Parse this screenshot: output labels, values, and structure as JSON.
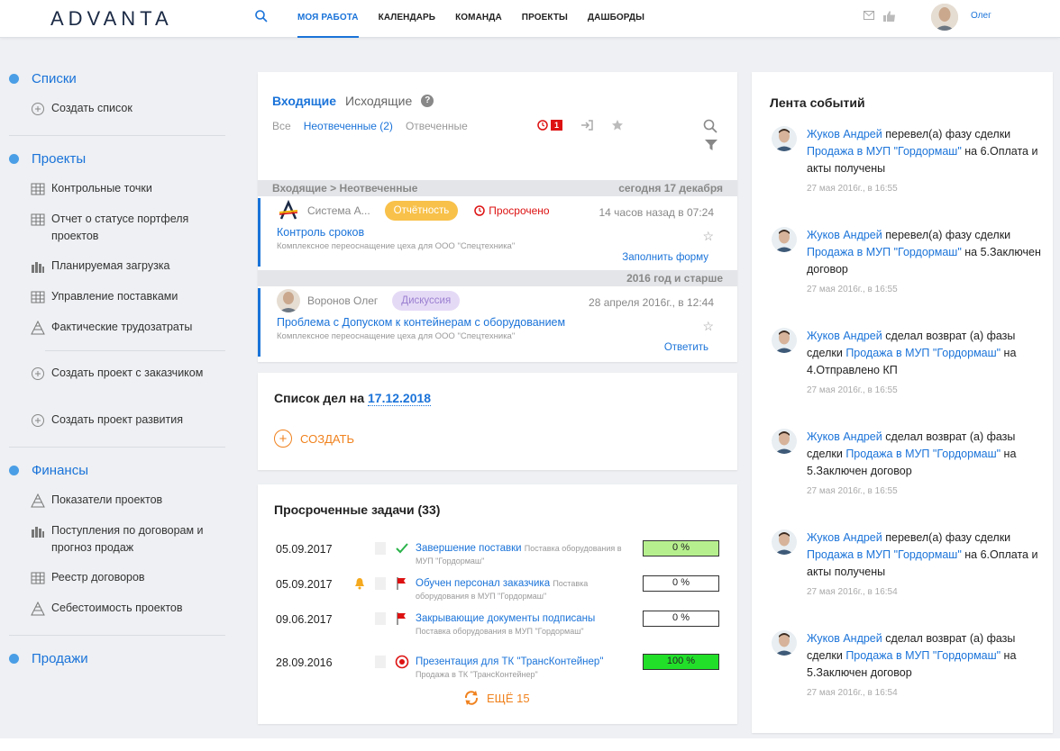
{
  "app": {
    "logo": "ADVANTA",
    "nav": [
      "МОЯ РАБОТА",
      "КАЛЕНДАРЬ",
      "КОМАНДА",
      "ПРОЕКТЫ",
      "ДАШБОРДЫ"
    ],
    "user": "Олег"
  },
  "sidebar": {
    "lists": {
      "title": "Списки",
      "create": "Создать список"
    },
    "projects": {
      "title": "Проекты",
      "items": [
        "Контрольные точки",
        "Отчет о статусе портфеля проектов",
        "Планируемая загрузка",
        "Управление поставками",
        "Фактические трудозатраты"
      ],
      "create1": "Создать проект с заказчиком",
      "create2": "Создать проект развития"
    },
    "finance": {
      "title": "Финансы",
      "items": [
        "Показатели проектов",
        "Поступления по договорам и прогноз продаж",
        "Реестр договоров",
        "Себестоимость проектов"
      ]
    },
    "sales": {
      "title": "Продажи"
    }
  },
  "inbox": {
    "tab_incoming": "Входящие",
    "tab_outgoing": "Исходящие",
    "help": "?",
    "filters": {
      "all": "Все",
      "unanswered": "Неотвеченные (2)",
      "answered": "Отвеченные"
    },
    "overdue_count": "1",
    "group1": {
      "path": "Входящие > Неотвеченные",
      "date": "сегодня 17 декабря"
    },
    "msg1": {
      "from": "Система А...",
      "tag": "Отчётность",
      "overdue": "Просрочено",
      "time": "14 часов назад в 07:24",
      "title": "Контроль сроков",
      "sub": "Комплексное переоснащение цеха для ООО \"Спецтехника\"",
      "action": "Заполнить форму"
    },
    "group2": {
      "date": "2016 год и старше"
    },
    "msg2": {
      "from": "Воронов Олег",
      "tag": "Дискуссия",
      "time": "28 апреля 2016г., в 12:44",
      "title": "Проблема с Допуском к контейнерам с оборудованием",
      "sub": "Комплексное переоснащение цеха для ООО \"Спецтехника\"",
      "action": "Ответить"
    }
  },
  "todo": {
    "title": "Список дел на",
    "date": "17.12.2018",
    "create": "СОЗДАТЬ"
  },
  "overdue": {
    "title": "Просроченные задачи (33)",
    "rows": [
      {
        "date": "05.09.2017",
        "name": "Завершение поставки",
        "proj": "Поставка оборудования в МУП \"Гордормаш\"",
        "progress": "0 %",
        "fill": "#b6f08e"
      },
      {
        "date": "05.09.2017",
        "name": "Обучен персонал заказчика",
        "proj": "Поставка оборудования в МУП \"Гордормаш\"",
        "progress": "0 %",
        "fill": "#ffffff"
      },
      {
        "date": "09.06.2017",
        "name": "Закрывающие документы подписаны",
        "proj": "Поставка оборудования в МУП \"Гордормаш\"",
        "progress": "0 %",
        "fill": "#ffffff"
      },
      {
        "date": "28.09.2016",
        "name": "Презентация для ТК \"ТрансКонтейнер\"",
        "proj": "Продажа в ТК \"ТрансКонтейнер\"",
        "progress": "100 %",
        "fill": "#22e02a"
      }
    ],
    "more": "ЕЩЁ 15"
  },
  "feed": {
    "title": "Лента событий",
    "items": [
      {
        "a": "Жуков Андрей",
        "b": " перевел(а) фазу ",
        "c": "сделки",
        "d": "Продажа в МУП \"Гордормаш\"",
        "e": " на 6.Оплата и акты получены",
        "time": "27 мая 2016г., в 16:55"
      },
      {
        "a": "Жуков Андрей",
        "b": " перевел(а) фазу ",
        "c": "сделки",
        "d": "Продажа в МУП \"Гордормаш\"",
        "e": " на 5.Заключен договор",
        "time": "27 мая 2016г., в 16:55"
      },
      {
        "a": "Жуков Андрей",
        "b": " сделал возврат (а) фазы ",
        "c": "сделки",
        "d": "Продажа в МУП \"Гордормаш\"",
        "e": " на 4.Отправлено КП",
        "time": "27 мая 2016г., в 16:55"
      },
      {
        "a": "Жуков Андрей",
        "b": " сделал возврат (а) фазы ",
        "c": "сделки",
        "d": "Продажа в МУП \"Гордормаш\"",
        "e": " на 5.Заключен договор",
        "time": "27 мая 2016г., в 16:55"
      },
      {
        "a": "Жуков Андрей",
        "b": " перевел(а) фазу ",
        "c": "сделки",
        "d": "Продажа в МУП \"Гордормаш\"",
        "e": " на 6.Оплата и акты получены",
        "time": "27 мая 2016г., в 16:54"
      },
      {
        "a": "Жуков Андрей",
        "b": " сделал возврат (а) фазы ",
        "c": "сделки",
        "d": "Продажа в МУП \"Гордормаш\"",
        "e": " на 5.Заключен договор",
        "time": "27 мая 2016г., в 16:54"
      }
    ]
  }
}
